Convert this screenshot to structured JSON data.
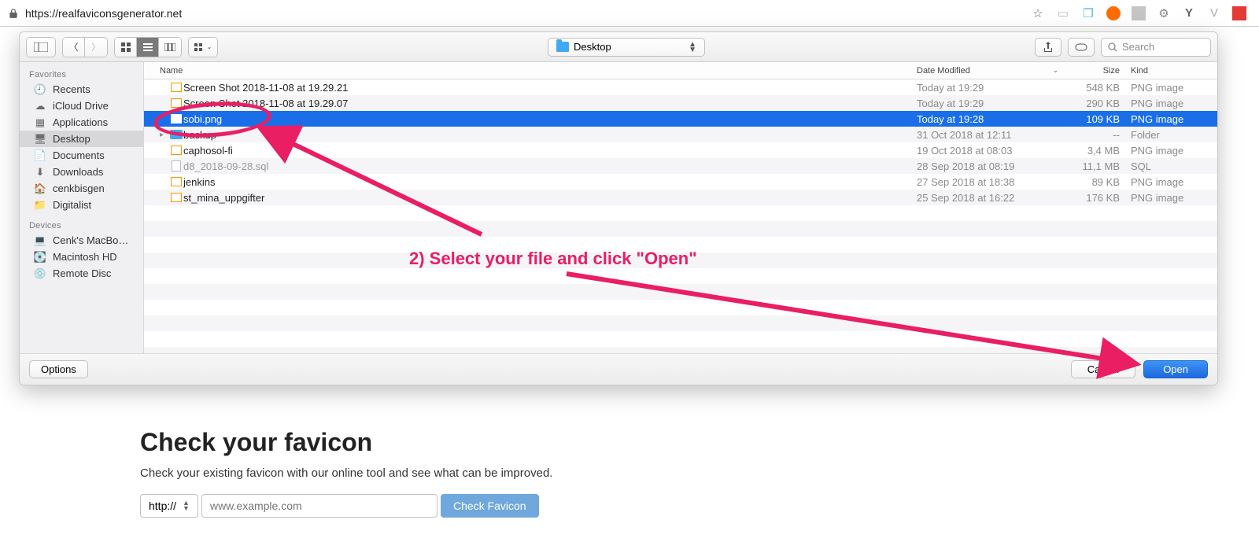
{
  "browser": {
    "url": "https://realfaviconsgenerator.net"
  },
  "toolbar": {
    "location": "Desktop",
    "search_placeholder": "Search"
  },
  "sidebar": {
    "favorites_header": "Favorites",
    "devices_header": "Devices",
    "favorites": [
      {
        "label": "Recents",
        "icon": "clock"
      },
      {
        "label": "iCloud Drive",
        "icon": "cloud"
      },
      {
        "label": "Applications",
        "icon": "apps"
      },
      {
        "label": "Desktop",
        "icon": "desktop",
        "selected": true
      },
      {
        "label": "Documents",
        "icon": "doc"
      },
      {
        "label": "Downloads",
        "icon": "down"
      },
      {
        "label": "cenkbisgen",
        "icon": "home"
      },
      {
        "label": "Digitalist",
        "icon": "folder"
      }
    ],
    "devices": [
      {
        "label": "Cenk's MacBo…",
        "icon": "laptop"
      },
      {
        "label": "Macintosh HD",
        "icon": "disk"
      },
      {
        "label": "Remote Disc",
        "icon": "disc"
      }
    ]
  },
  "columns": {
    "name": "Name",
    "date": "Date Modified",
    "size": "Size",
    "kind": "Kind"
  },
  "files": [
    {
      "name": "Screen Shot 2018-11-08 at 19.29.21",
      "date": "Today at 19:29",
      "size": "548 KB",
      "kind": "PNG image",
      "type": "img"
    },
    {
      "name": "Screen Shot 2018-11-08 at 19.29.07",
      "date": "Today at 19:29",
      "size": "290 KB",
      "kind": "PNG image",
      "type": "img"
    },
    {
      "name": "sobi.png",
      "date": "Today at 19:28",
      "size": "109 KB",
      "kind": "PNG image",
      "type": "img",
      "selected": true
    },
    {
      "name": "backup",
      "date": "31 Oct 2018 at 12:11",
      "size": "--",
      "kind": "Folder",
      "type": "folder"
    },
    {
      "name": "caphosol-fi",
      "date": "19 Oct 2018 at 08:03",
      "size": "3,4 MB",
      "kind": "PNG image",
      "type": "img"
    },
    {
      "name": "d8_2018-09-28.sql",
      "date": "28 Sep 2018 at 08:19",
      "size": "11,1 MB",
      "kind": "SQL",
      "type": "file",
      "dim": true
    },
    {
      "name": "jenkins",
      "date": "27 Sep 2018 at 18:38",
      "size": "89 KB",
      "kind": "PNG image",
      "type": "img"
    },
    {
      "name": "st_mina_uppgifter",
      "date": "25 Sep 2018 at 16:22",
      "size": "176 KB",
      "kind": "PNG image",
      "type": "img"
    }
  ],
  "footer": {
    "options": "Options",
    "cancel": "Cancel",
    "open": "Open"
  },
  "site": {
    "heading": "Check your favicon",
    "sub": "Check your existing favicon with our online tool and see what can be improved.",
    "proto": "http://",
    "placeholder": "www.example.com",
    "button": "Check Favicon"
  },
  "annotation": {
    "text": "2) Select your file and click \"Open\""
  }
}
